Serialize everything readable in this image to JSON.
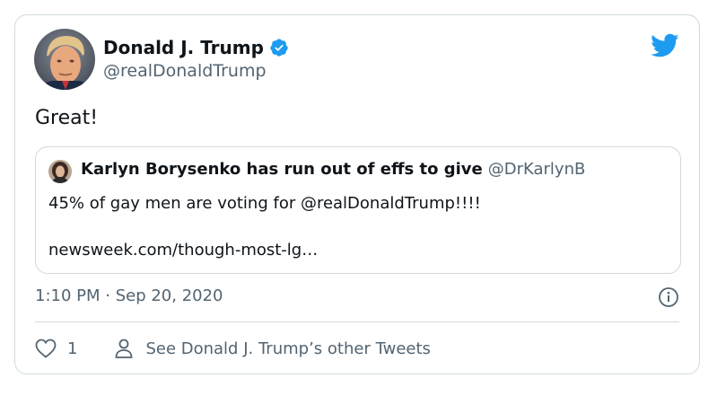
{
  "colors": {
    "accent": "#1d9bf0",
    "text_primary": "#0f1419",
    "text_secondary": "#536471",
    "border": "#cfd9de"
  },
  "tweet": {
    "author": {
      "name": "Donald J. Trump",
      "handle": "@realDonaldTrump",
      "verified": true
    },
    "text": "Great!",
    "timestamp": "1:10 PM · Sep 20, 2020"
  },
  "quoted_tweet": {
    "author_name": "Karlyn Borysenko has run out of effs to give",
    "handle": "@DrKarlynB",
    "text": "45% of gay men are voting for @realDonaldTrump!!!!",
    "link": "newsweek.com/though-most-lg…"
  },
  "actions": {
    "like_count": "1",
    "see_other_tweets": "See Donald J. Trump’s other Tweets"
  },
  "icons": {
    "brand": "twitter-bird-icon",
    "verified": "verified-badge-icon",
    "info": "info-icon",
    "like": "heart-icon",
    "profile": "person-icon"
  }
}
